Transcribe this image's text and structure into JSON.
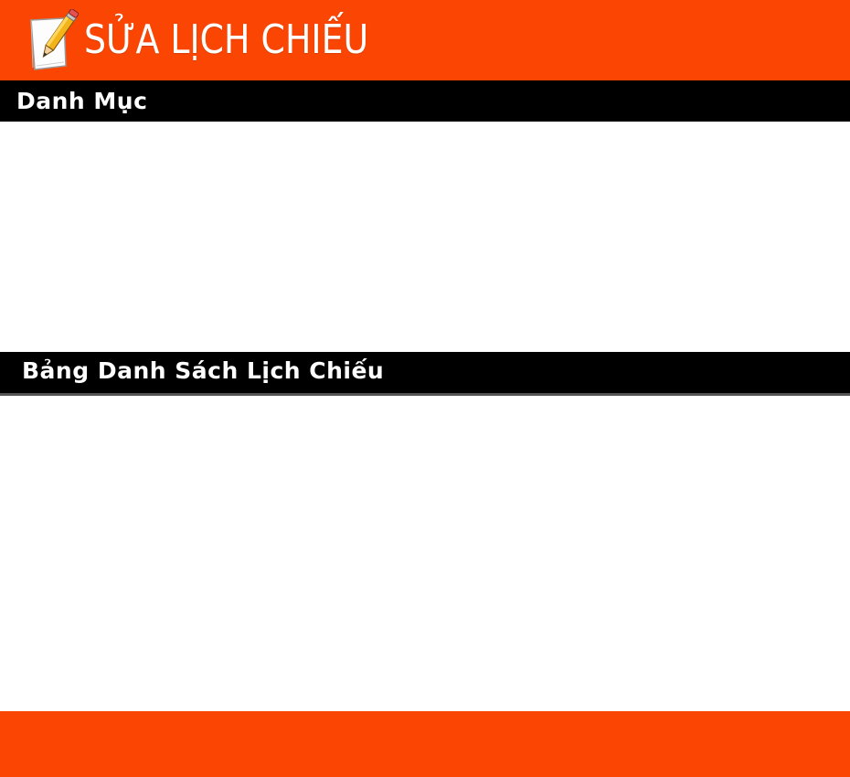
{
  "header": {
    "title": "SỬA LỊCH CHIẾU",
    "icon": "edit-pencil-icon",
    "background_color": "#fb4603"
  },
  "sections": {
    "category_title": "Danh Mục",
    "schedule_table_title": "Bảng Danh Sách Lịch Chiếu"
  },
  "footer": {
    "background_color": "#fb4603"
  },
  "colors": {
    "accent": "#fb4603",
    "section_bar": "#000000",
    "text_on_dark": "#ffffff"
  }
}
